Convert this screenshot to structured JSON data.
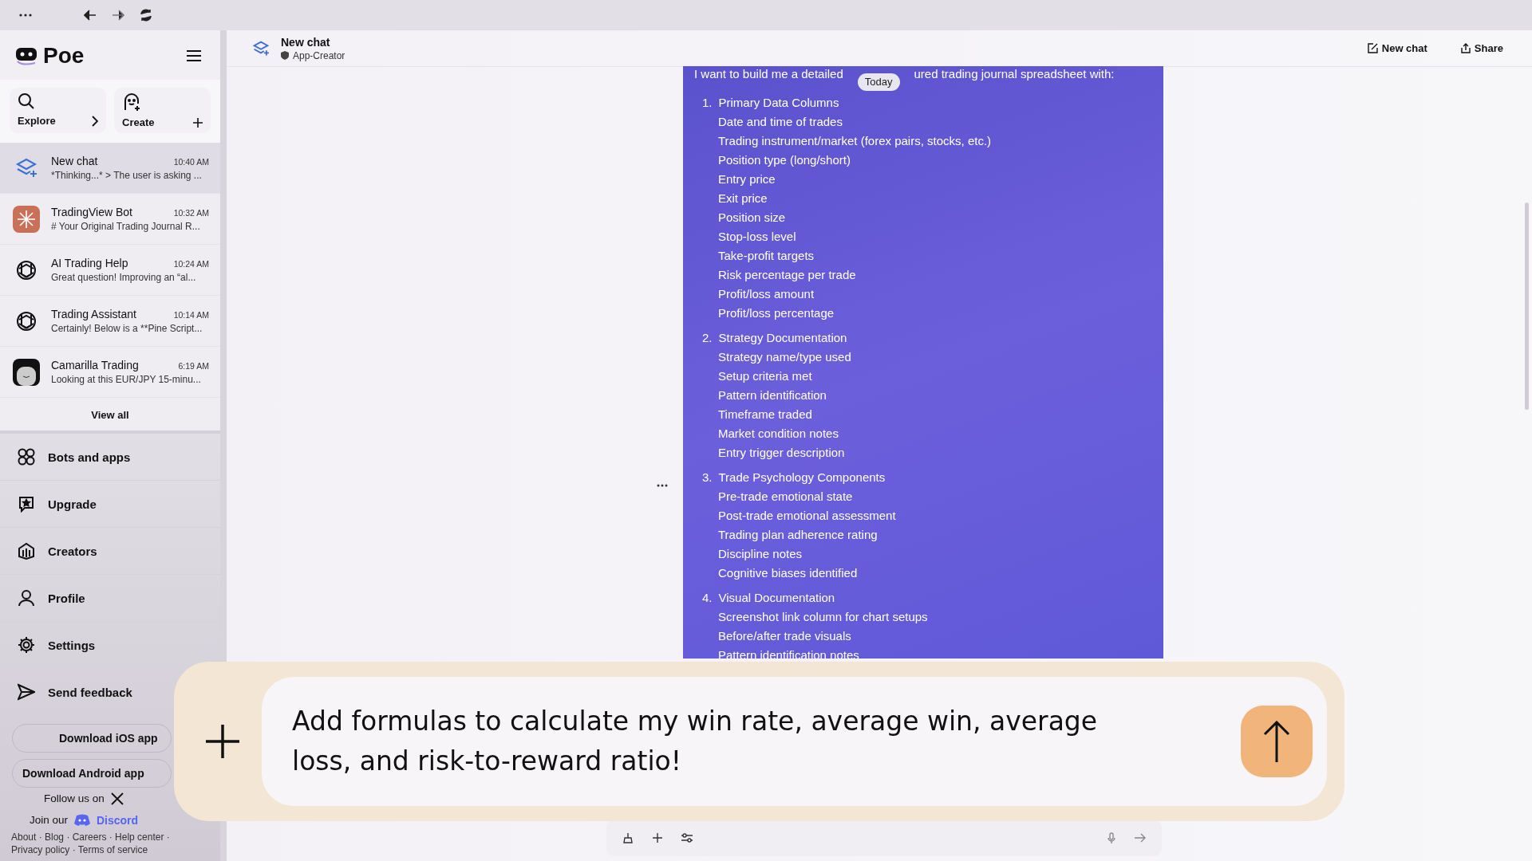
{
  "sidebar": {
    "logo": "Poe",
    "explore": "Explore",
    "create": "Create",
    "chats": [
      {
        "name": "New chat",
        "time": "10:40 AM",
        "preview": "*Thinking...* > The user is asking ...",
        "selected": true
      },
      {
        "name": "TradingView Bot",
        "time": "10:32 AM",
        "preview": "# Your Original Trading Journal R...",
        "selected": false
      },
      {
        "name": "AI Trading Help",
        "time": "10:24 AM",
        "preview": "Great question! Improving an “al...",
        "selected": false
      },
      {
        "name": "Trading Assistant",
        "time": "10:14 AM",
        "preview": "Certainly! Below is a **Pine Script...",
        "selected": false
      },
      {
        "name": "Camarilla Trading",
        "time": "6:19 AM",
        "preview": "Looking at this EUR/JPY 15-minu...",
        "selected": false
      }
    ],
    "view_all": "View all",
    "nav": [
      {
        "label": "Bots and apps"
      },
      {
        "label": "Upgrade"
      },
      {
        "label": "Creators"
      },
      {
        "label": "Profile"
      },
      {
        "label": "Settings"
      },
      {
        "label": "Send feedback"
      }
    ],
    "download_buttons": [
      "Download iOS app",
      "Download Android app"
    ],
    "follow": "Follow us on",
    "join": "Join our",
    "discord": "Discord",
    "footer_links": [
      "About · Blog · Careers · Help center ·",
      "Privacy policy · Terms of service"
    ]
  },
  "header": {
    "title": "New chat",
    "subtitle": "App-Creator",
    "actions": [
      "New chat",
      "Share"
    ]
  },
  "message": {
    "intro_before": "I want to build me a detailed",
    "intro_after": "ured trading journal spreadsheet with:",
    "date_badge": "Today",
    "sections": [
      {
        "number": "1.",
        "title": "Primary Data Columns",
        "items": [
          "Date and time of trades",
          "Trading instrument/market (forex pairs, stocks, etc.)",
          "Position type (long/short)",
          "Entry price",
          "Exit price",
          "Position size",
          "Stop-loss level",
          "Take-profit targets",
          "Risk percentage per trade",
          "Profit/loss amount",
          "Profit/loss percentage"
        ]
      },
      {
        "number": "2.",
        "title": "Strategy Documentation",
        "items": [
          "Strategy name/type used",
          "Setup criteria met",
          "Pattern identification",
          "Timeframe traded",
          "Market condition notes",
          "Entry trigger description"
        ]
      },
      {
        "number": "3.",
        "title": "Trade Psychology Components",
        "items": [
          "Pre-trade emotional state",
          "Post-trade emotional assessment",
          "Trading plan adherence rating",
          "Discipline notes",
          "Cognitive biases identified"
        ]
      },
      {
        "number": "4.",
        "title": "Visual Documentation",
        "items": [
          "Screenshot link column for chart setups",
          "Before/after trade visuals",
          "Pattern identification notes"
        ]
      }
    ]
  },
  "composer": {
    "value": "Add formulas to calculate my win rate, average win, average loss, and risk-to-reward ratio!"
  }
}
